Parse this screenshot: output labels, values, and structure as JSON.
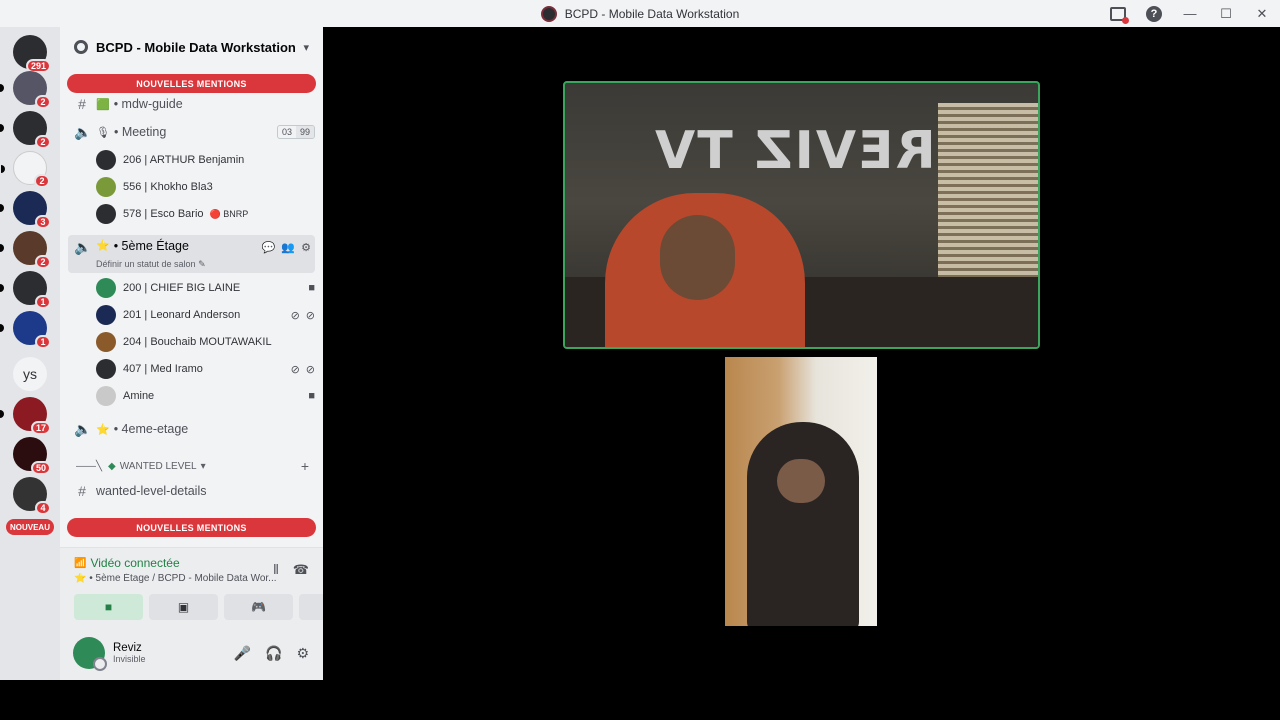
{
  "window": {
    "title": "BCPD - Mobile Data Workstation"
  },
  "guilds": {
    "items": [
      {
        "badge": "291"
      },
      {
        "badge": "2"
      },
      {
        "badge": "2"
      },
      {
        "badge": "2"
      },
      {
        "badge": "3"
      },
      {
        "badge": "2"
      },
      {
        "badge": "1"
      },
      {
        "badge": "1"
      },
      {
        "label": "ys"
      },
      {
        "badge": "17"
      },
      {
        "badge": "50"
      },
      {
        "badge": "4"
      }
    ],
    "nouveau": "NOUVEAU"
  },
  "server": {
    "name": "BCPD - Mobile Data Workstation"
  },
  "banners": {
    "top": "NOUVELLES MENTIONS",
    "bottom": "NOUVELLES MENTIONS"
  },
  "channels": {
    "mdw_guide": "• mdw-guide",
    "meeting": {
      "name": "• Meeting",
      "count_a": "03",
      "count_b": "99"
    },
    "meeting_users": [
      {
        "name": "206 | ARTHUR Benjamin"
      },
      {
        "name": "556 | Khokho Bla3"
      },
      {
        "name": "578 | Esco Bario",
        "tag": "BNRP"
      }
    ],
    "etage5": {
      "name": "• 5ème Étage",
      "status": "Définir un statut de salon"
    },
    "etage5_users": [
      {
        "name": "200 | CHIEF BIG LAINE"
      },
      {
        "name": "201 | Leonard Anderson"
      },
      {
        "name": "204 | Bouchaib MOUTAWAKIL"
      },
      {
        "name": "407 | Med Iramo"
      },
      {
        "name": "Amine"
      }
    ],
    "etage4": "• 4eme-etage",
    "category": "WANTED LEVEL",
    "wanted": "wanted-level-details"
  },
  "voice": {
    "status": "Vidéo connectée",
    "location": "• 5ème Étage / BCPD - Mobile Data Wor..."
  },
  "user": {
    "name": "Reviz",
    "status": "Invisible"
  },
  "stream": {
    "sign": "REVIZ TV"
  },
  "colors": {
    "accent_red": "#da373c",
    "connected_green": "#248046",
    "speaking_border": "#3ba55d"
  }
}
